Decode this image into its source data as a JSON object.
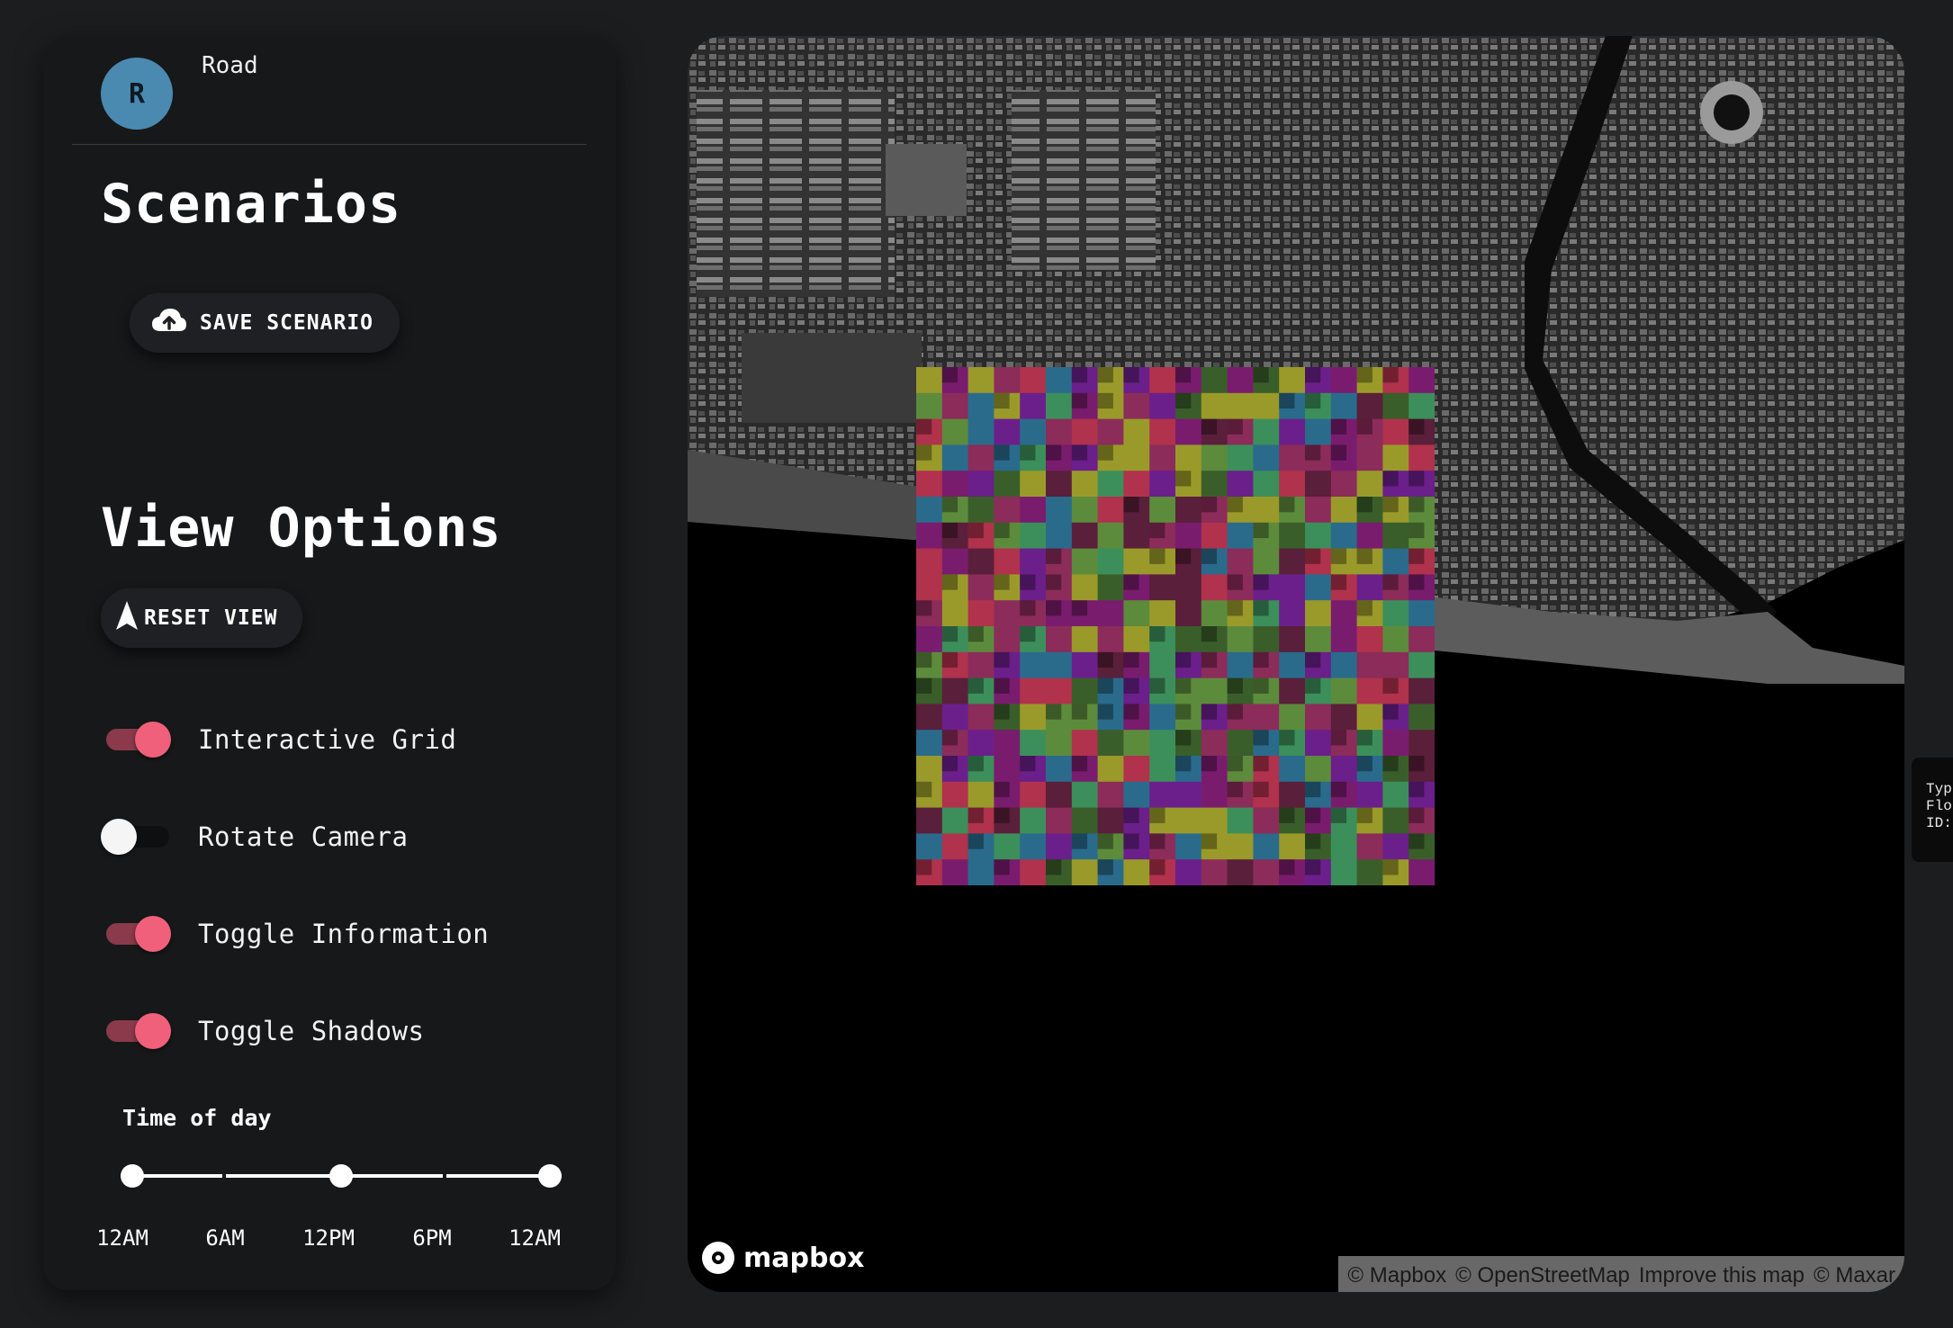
{
  "user": {
    "avatar_initial": "R",
    "name": "Road"
  },
  "scenarios": {
    "heading": "Scenarios",
    "save_button": {
      "label": "SAVE SCENARIO",
      "icon": "cloud-upload-icon"
    }
  },
  "view_options": {
    "heading": "View Options",
    "reset_button": {
      "label": "RESET VIEW",
      "icon": "navigation-arrow-icon"
    },
    "toggles": [
      {
        "label": "Interactive Grid",
        "on": true
      },
      {
        "label": "Rotate Camera",
        "on": false
      },
      {
        "label": "Toggle Information",
        "on": true
      },
      {
        "label": "Toggle Shadows",
        "on": true
      }
    ]
  },
  "time_of_day": {
    "label": "Time of day",
    "ticks": [
      "12AM",
      "6AM",
      "12PM",
      "6PM",
      "12AM"
    ],
    "handle_positions": [
      0,
      0.5,
      1
    ]
  },
  "map": {
    "logo_text": "mapbox",
    "attribution": [
      "© Mapbox",
      "© OpenStreetMap",
      "Improve this map",
      "© Maxar"
    ],
    "info_popup_lines": [
      "Typ",
      "Flo",
      "ID:"
    ]
  },
  "colors": {
    "accent": "#f0607a",
    "grid_palette": [
      "#8b2c5a",
      "#7a1c6e",
      "#2a6b8c",
      "#5d8b3c",
      "#9a9a2a",
      "#b0324c",
      "#6b1f8a",
      "#3c8f5a",
      "#5a1f3a",
      "#3a5e2a"
    ]
  }
}
